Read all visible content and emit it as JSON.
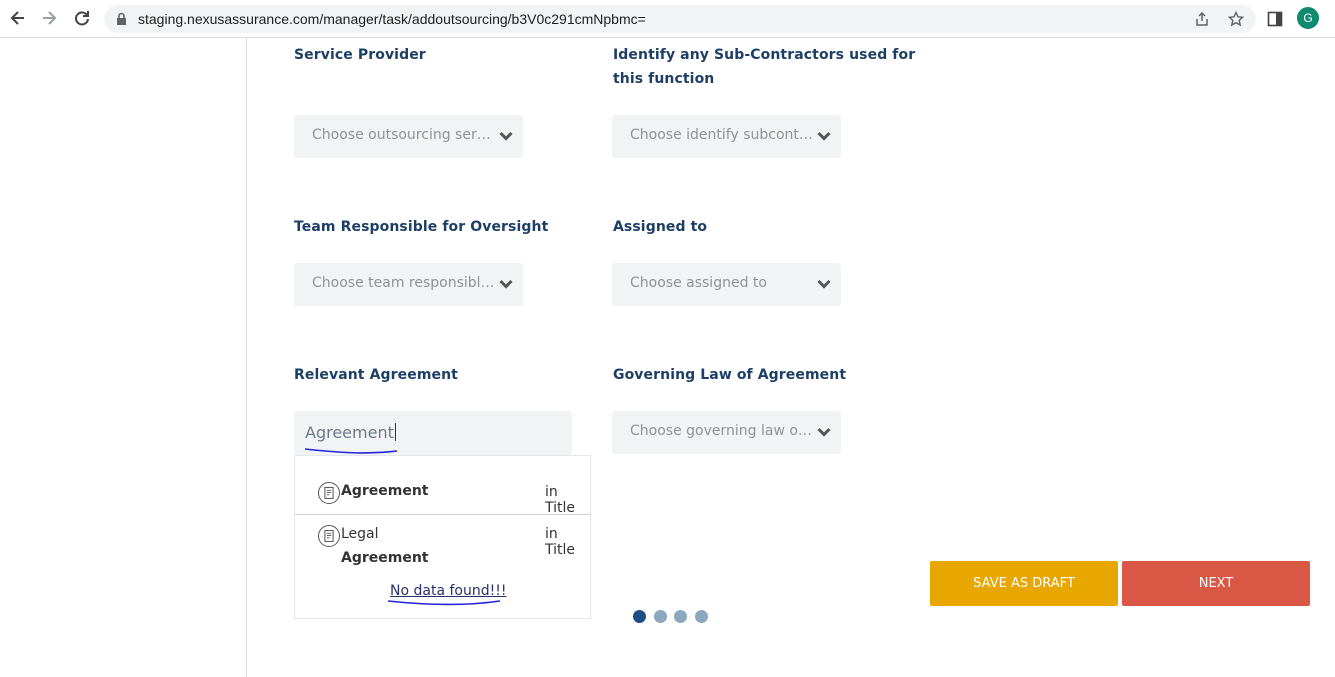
{
  "browser": {
    "url": "staging.nexusassurance.com/manager/task/addoutsourcing/b3V0c291cmNpbmc=",
    "profile_initial": "G",
    "icons": [
      "back-icon",
      "forward-icon",
      "reload-icon",
      "lock-icon",
      "share-icon",
      "star-icon",
      "side-panel-icon"
    ]
  },
  "form": {
    "service_provider": {
      "label": "Service Provider",
      "placeholder": "Choose outsourcing service..."
    },
    "subcontractors": {
      "label_line1": "Identify any Sub-Contractors used for",
      "label_line2": "this function",
      "placeholder": "Choose identify subcontrac..."
    },
    "team_oversight": {
      "label": "Team Responsible for Oversight",
      "placeholder": "Choose team responsible f..."
    },
    "assigned_to": {
      "label": "Assigned to",
      "placeholder": "Choose assigned to"
    },
    "relevant_agreement": {
      "label": "Relevant Agreement",
      "value": "Agreement",
      "results": [
        {
          "prefix": "",
          "match": "Agreement",
          "where": "in Title"
        },
        {
          "prefix": "Legal",
          "match": "Agreement",
          "where": "in Title"
        }
      ],
      "no_data": "No data found!!!"
    },
    "governing_law": {
      "label": "Governing Law of Agreement",
      "placeholder": "Choose governing law of ag..."
    }
  },
  "actions": {
    "save_draft": "SAVE AS DRAFT",
    "next": "NEXT"
  },
  "pagination": {
    "total_steps": 4,
    "current_step": 1
  },
  "colors": {
    "label": "#1d3f66",
    "draft": "#e8a600",
    "next": "#d95745",
    "dot_active": "#1d4f86",
    "dot_inactive": "#8da7bf"
  }
}
